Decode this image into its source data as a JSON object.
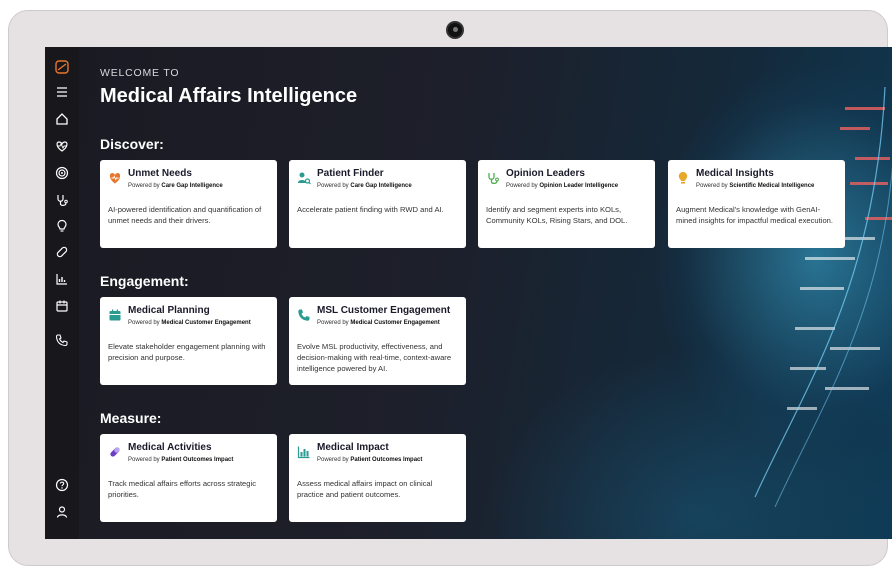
{
  "header": {
    "welcome": "WELCOME TO",
    "title": "Medical Affairs Intelligence"
  },
  "sidebar": {
    "items": [
      {
        "icon": "logo-icon"
      },
      {
        "icon": "menu-icon"
      },
      {
        "icon": "home-icon"
      },
      {
        "icon": "heart-pulse-icon"
      },
      {
        "icon": "target-icon"
      },
      {
        "icon": "stethoscope-icon"
      },
      {
        "icon": "lightbulb-icon"
      },
      {
        "icon": "pill-icon"
      },
      {
        "icon": "chart-icon"
      },
      {
        "icon": "calendar-icon"
      },
      {
        "icon": "phone-icon"
      },
      {
        "icon": "help-icon"
      },
      {
        "icon": "user-icon"
      }
    ]
  },
  "sections": {
    "discover": "Discover:",
    "engagement": "Engagement:",
    "measure": "Measure:"
  },
  "powered_prefix": "Powered by",
  "cards": {
    "unmet_needs": {
      "title": "Unmet Needs",
      "source": "Care Gap Intelligence",
      "desc": "AI-powered identification and quantification of unmet needs and their drivers.",
      "icon": "heart-icon",
      "color": "#e8762c"
    },
    "patient_finder": {
      "title": "Patient Finder",
      "source": "Care Gap Intelligence",
      "desc": "Accelerate patient finding with RWD and AI.",
      "icon": "person-search-icon",
      "color": "#2a9b8f"
    },
    "opinion_leaders": {
      "title": "Opinion Leaders",
      "source": "Opinion Leader Intelligence",
      "desc": "Identify and segment experts into KOLs, Community KOLs, Rising Stars, and DOL.",
      "icon": "stethoscope-icon",
      "color": "#4cae4c"
    },
    "medical_insights": {
      "title": "Medical Insights",
      "source": "Scientific Medical Intelligence",
      "desc": "Augment Medical's knowledge with GenAI-mined insights for impactful medical execution.",
      "icon": "lightbulb-icon",
      "color": "#e8a82c"
    },
    "medical_planning": {
      "title": "Medical Planning",
      "source": "Medical Customer Engagement",
      "desc": "Elevate stakeholder engagement planning with precision and purpose.",
      "icon": "calendar-icon",
      "color": "#2a9b8f"
    },
    "msl_engagement": {
      "title": "MSL Customer Engagement",
      "source": "Medical Customer Engagement",
      "desc": "Evolve MSL productivity, effectiveness, and decision-making with real-time, context-aware intelligence powered by AI.",
      "icon": "phone-icon",
      "color": "#2a9b8f"
    },
    "medical_activities": {
      "title": "Medical Activities",
      "source": "Patient Outcomes Impact",
      "desc": "Track medical affairs efforts across strategic priorities.",
      "icon": "pill-icon",
      "color": "#6a3fc7"
    },
    "medical_impact": {
      "title": "Medical Impact",
      "source": "Patient Outcomes Impact",
      "desc": "Assess medical affairs impact on clinical practice and patient outcomes.",
      "icon": "chart-icon",
      "color": "#2a9b8f"
    }
  }
}
